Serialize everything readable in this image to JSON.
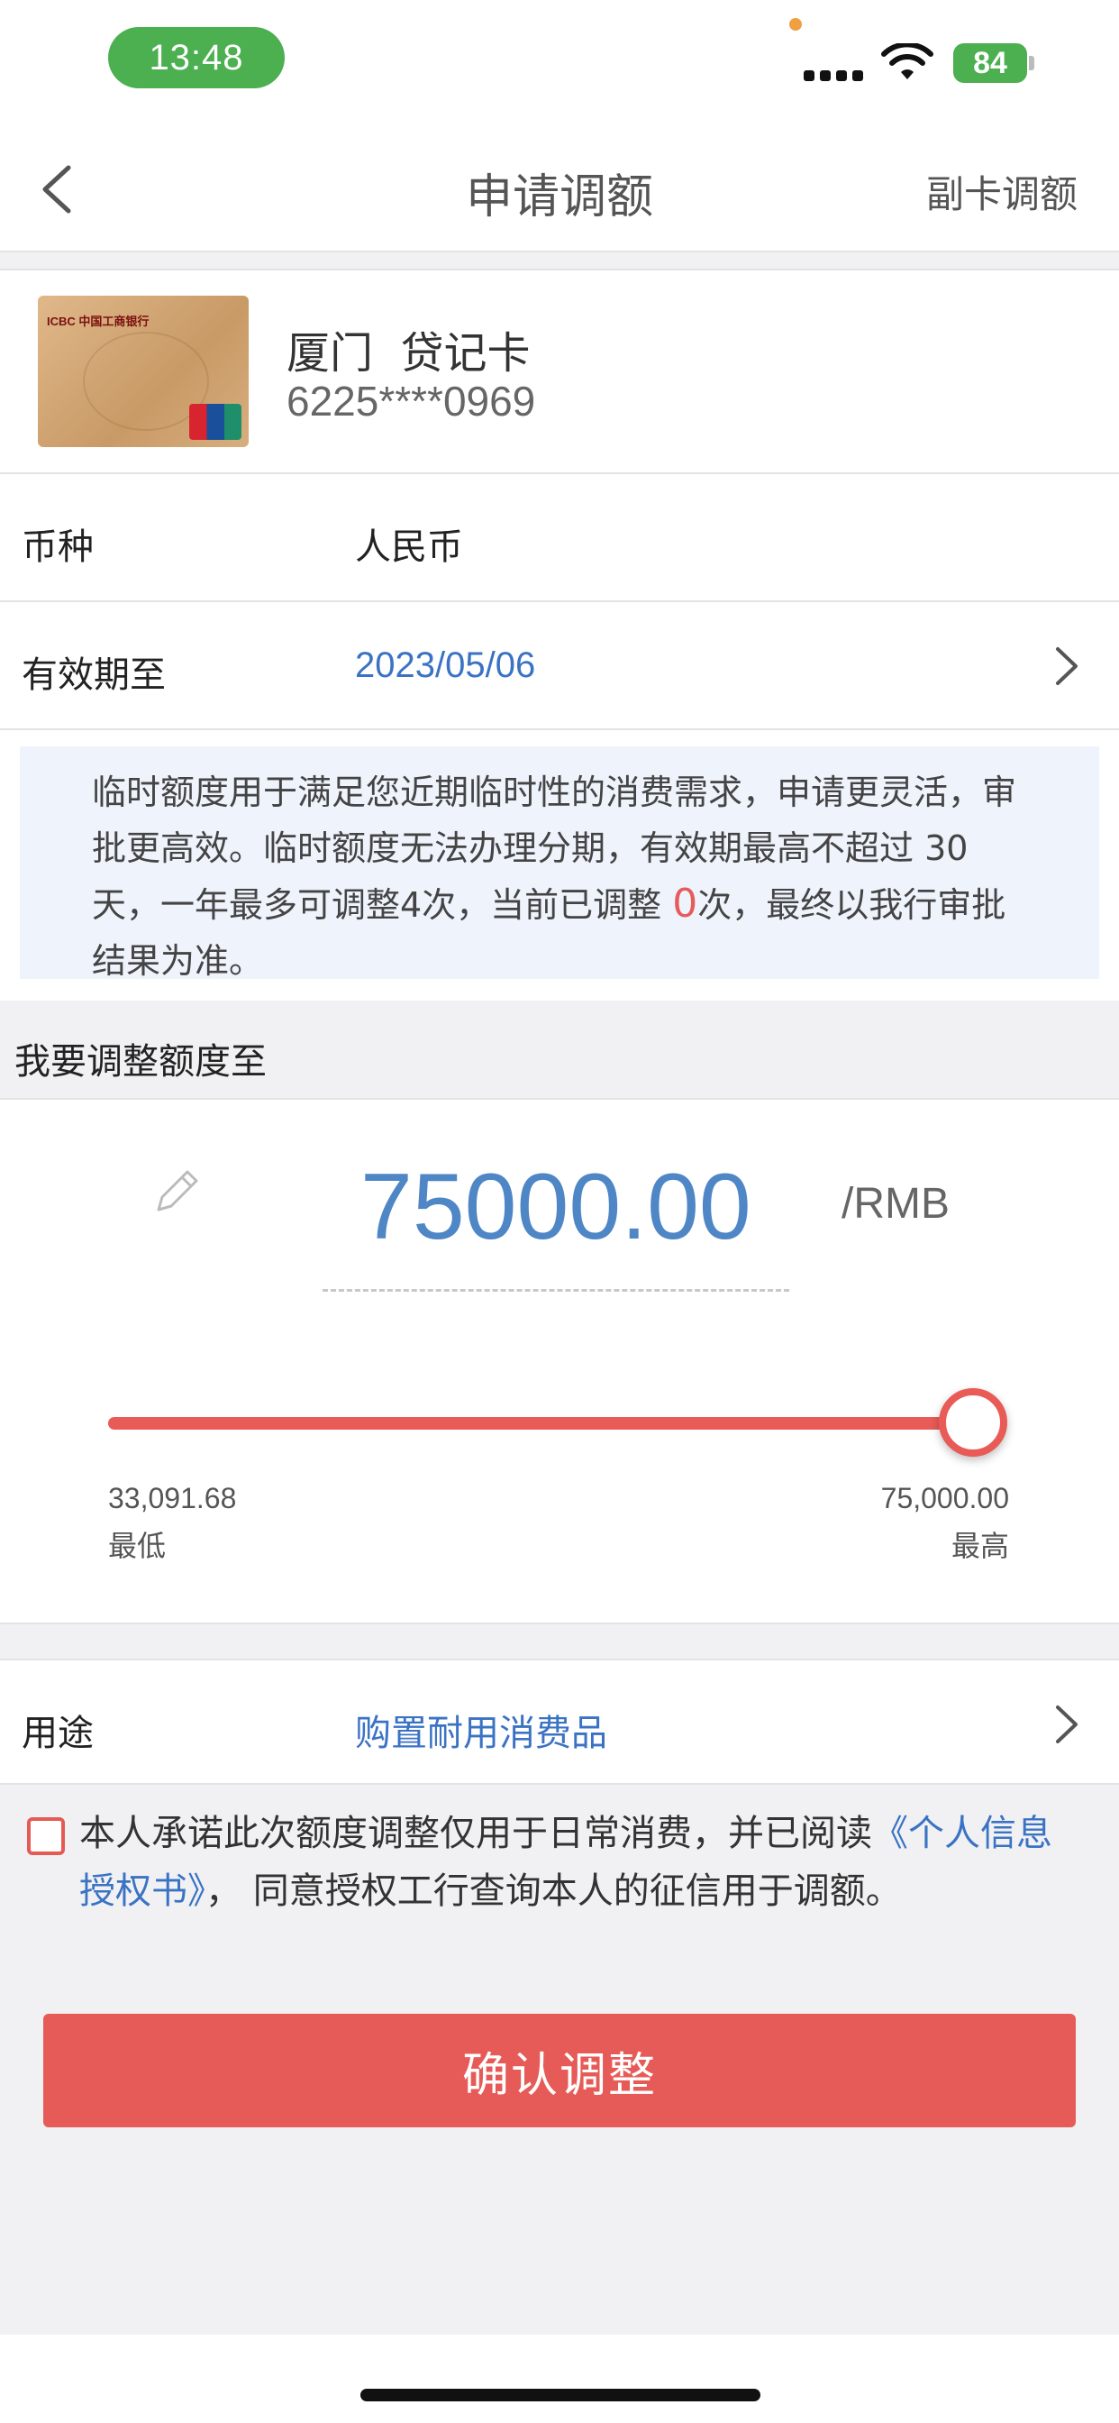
{
  "status_bar": {
    "time": "13:48",
    "battery": "84"
  },
  "nav": {
    "title": "申请调额",
    "right_action": "副卡调额",
    "back_icon": "chevron-left-icon"
  },
  "card": {
    "name": "厦门  贷记卡",
    "number": "6225****0969",
    "bank_logo_text": "ICBC 中国工商银行"
  },
  "currency": {
    "label": "币种",
    "value": "人民币"
  },
  "expiry": {
    "label": "有效期至",
    "value": "2023/05/06"
  },
  "notice": {
    "text_before": "临时额度用于满足您近期临时性的消费需求，申请更灵活，审批更高效。临时额度无法办理分期，有效期最高不超过 30天，一年最多可调整4次，当前已调整 ",
    "count": "0",
    "text_after": "次，最终以我行审批结果为准。"
  },
  "section_header": "我要调整额度至",
  "amount": {
    "value": "75000.00",
    "unit": "/RMB",
    "min_value": "33,091.68",
    "min_label": "最低",
    "max_value": "75,000.00",
    "max_label": "最高",
    "slider_fraction": 1.0
  },
  "purpose": {
    "label": "用途",
    "value": "购置耐用消费品"
  },
  "agreement": {
    "text_before": "本人承诺此次额度调整仅用于日常消费，并已阅读",
    "link": "《个人信息授权书》",
    "text_after": "， 同意授权工行查询本人的征信用于调额。"
  },
  "confirm_button": "确认调整",
  "colors": {
    "accent_red": "#e65b57",
    "link_blue": "#3b73c4",
    "amount_blue": "#4f86c6",
    "status_green": "#4caf50"
  }
}
